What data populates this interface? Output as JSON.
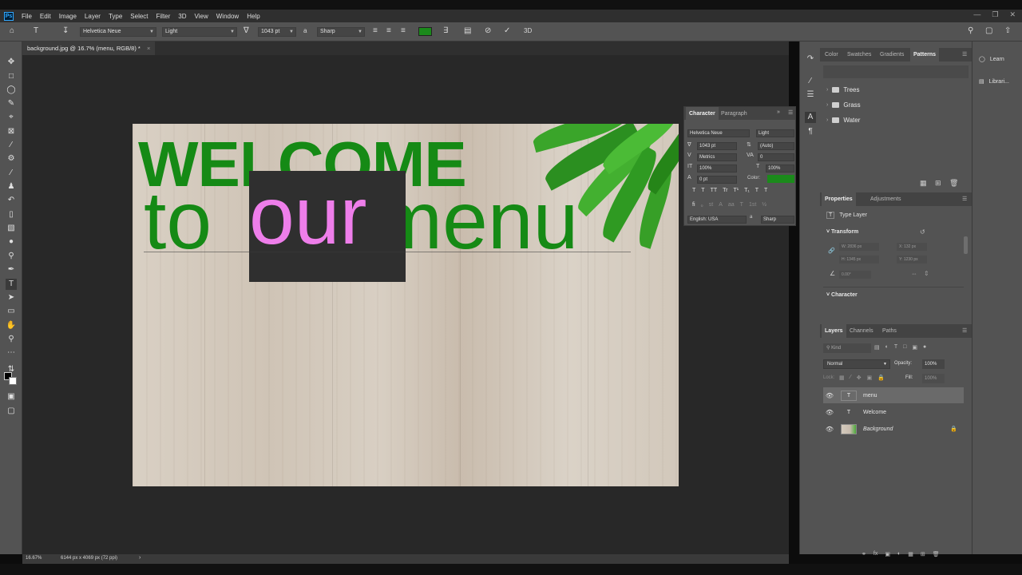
{
  "app": {
    "logo": "Ps",
    "menu": [
      "File",
      "Edit",
      "Image",
      "Layer",
      "Type",
      "Select",
      "Filter",
      "3D",
      "View",
      "Window",
      "Help"
    ]
  },
  "options": {
    "font_family": "Helvetica Neue",
    "font_style": "Light",
    "font_size": "1043 pt",
    "aa_label": "a",
    "antialias": "Sharp",
    "color": "#1b8a1b",
    "btn_3d": "3D"
  },
  "document": {
    "tab_title": "background.jpg @ 16.7% (menu, RGB/8) *",
    "zoom": "16.67%",
    "dimensions": "6144 px x 4069 px (72 ppi)"
  },
  "canvas": {
    "line1": "WELCOME",
    "line2_pre": "to ",
    "line2_selected": "our",
    "line2_post": " menu",
    "text_color": "#158a15",
    "selection_text_color": "#ee7eea"
  },
  "character_panel": {
    "tabs": [
      "Character",
      "Paragraph"
    ],
    "font_family": "Helvetica Neue",
    "font_style": "Light",
    "size": "1043 pt",
    "leading": "(Auto)",
    "kerning": "Metrics",
    "tracking": "0",
    "vertical_scale": "100%",
    "horizontal_scale": "100%",
    "baseline_shift": "0 pt",
    "color_label": "Color:",
    "color": "#1b8a1b",
    "type_styles": [
      "T",
      "T",
      "TT",
      "Tr",
      "T¹",
      "T₁",
      "T",
      "T"
    ],
    "opentype": [
      "fi",
      "ℴ",
      "st",
      "A",
      "aa",
      "T",
      "1st",
      "½"
    ],
    "language": "English: USA",
    "aa_label": "a",
    "antialias": "Sharp"
  },
  "top_panel": {
    "tabs": [
      "Color",
      "Swatches",
      "Gradients",
      "Patterns"
    ],
    "active_tab": "Patterns",
    "pattern_groups": [
      "Trees",
      "Grass",
      "Water"
    ]
  },
  "learn_strip": {
    "items": [
      "Learn",
      "Librari..."
    ]
  },
  "properties": {
    "tabs": [
      "Properties",
      "Adjustments"
    ],
    "layer_type": "Type Layer",
    "section_transform": "Transform",
    "w_label": "W:",
    "w_value": "2836 px",
    "h_label": "H:",
    "h_value": "1345 px",
    "x_label": "X:",
    "x_value": "132 px",
    "y_label": "Y:",
    "y_value": "1230 px",
    "angle_value": "0.00°",
    "section_character": "Character"
  },
  "layers": {
    "tabs": [
      "Layers",
      "Channels",
      "Paths"
    ],
    "search_placeholder": "Kind",
    "blend_mode": "Normal",
    "opacity_label": "Opacity:",
    "opacity": "100%",
    "lock_label": "Lock:",
    "fill_label": "Fill:",
    "fill": "100%",
    "items": [
      {
        "name": "menu",
        "type": "text",
        "selected": true
      },
      {
        "name": "Welcome",
        "type": "text",
        "selected": false
      },
      {
        "name": "Background",
        "type": "image",
        "selected": false,
        "locked": true
      }
    ]
  }
}
